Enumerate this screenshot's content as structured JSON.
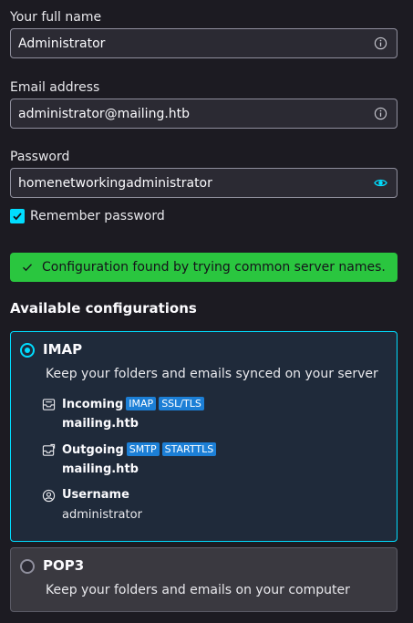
{
  "form": {
    "name_label": "Your full name",
    "name_value": "Administrator",
    "email_label": "Email address",
    "email_value": "administrator@mailing.htb",
    "password_label": "Password",
    "password_value": "homenetworkingadministrator",
    "remember_label": "Remember password",
    "remember_checked": true
  },
  "status": {
    "success_text": "Configuration found by trying common server names."
  },
  "configs": {
    "title": "Available configurations",
    "imap": {
      "title": "IMAP",
      "description": "Keep your folders and emails synced on your server",
      "incoming_label": "Incoming",
      "incoming_badges": [
        "IMAP",
        "SSL/TLS"
      ],
      "incoming_host": "mailing.htb",
      "outgoing_label": "Outgoing",
      "outgoing_badges": [
        "SMTP",
        "STARTTLS"
      ],
      "outgoing_host": "mailing.htb",
      "username_label": "Username",
      "username_value": "administrator"
    },
    "pop3": {
      "title": "POP3",
      "description": "Keep your folders and emails on your computer"
    }
  },
  "colors": {
    "accent": "#00ddff",
    "success": "#2ac63f",
    "badge": "#1c7fd6"
  }
}
